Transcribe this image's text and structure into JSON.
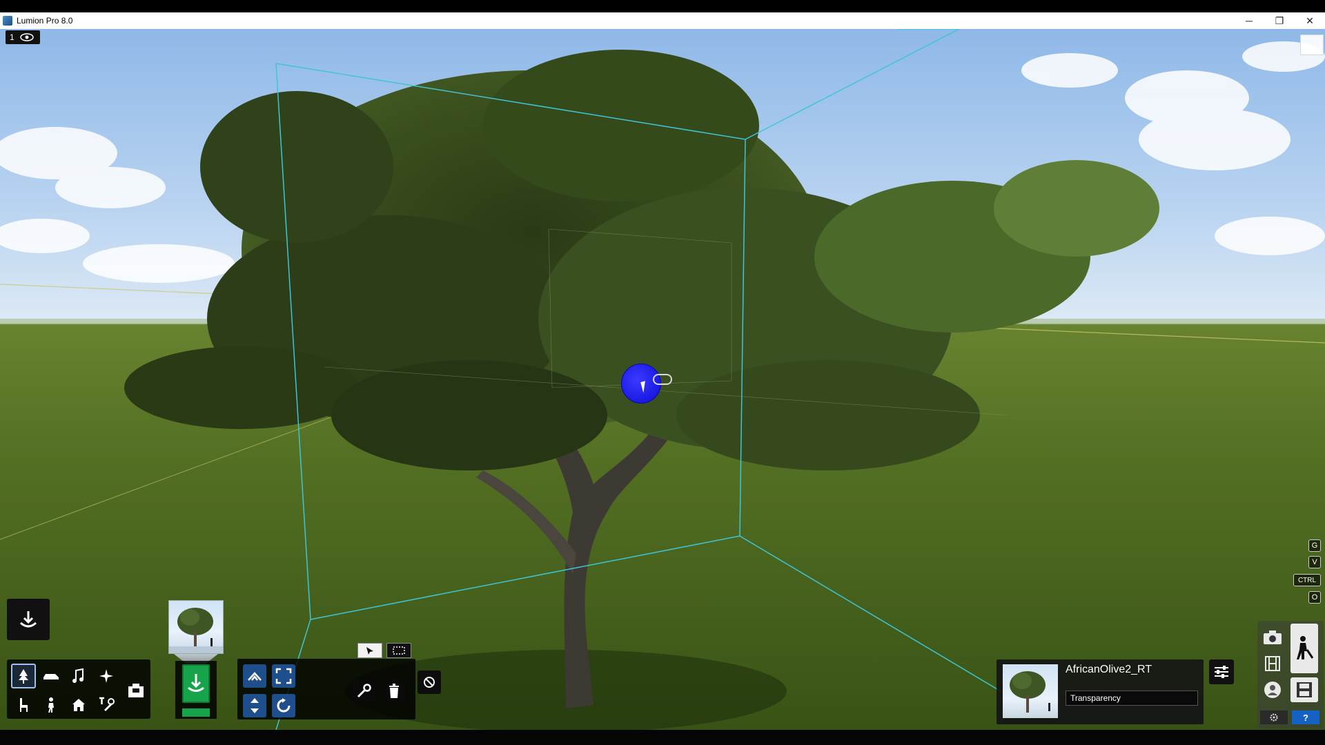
{
  "window": {
    "title": "Lumion Pro 8.0",
    "minimize_glyph": "─",
    "maximize_glyph": "❐",
    "close_glyph": "✕"
  },
  "viewport": {
    "camera_number": "1",
    "eye_icon": "eye-icon"
  },
  "bottom_toolbar": {
    "place_button_icon": "place-object-icon",
    "categories": [
      {
        "name": "nature",
        "icon": "tree-icon",
        "active": true
      },
      {
        "name": "transport",
        "icon": "car-icon",
        "active": false
      },
      {
        "name": "sound",
        "icon": "music-note-icon",
        "active": false
      },
      {
        "name": "special-effects",
        "icon": "sparkle-icon",
        "active": false
      },
      {
        "name": "indoor",
        "icon": "chair-icon",
        "active": false
      },
      {
        "name": "people-animals",
        "icon": "person-icon",
        "active": false
      },
      {
        "name": "outdoor",
        "icon": "house-icon",
        "active": false
      },
      {
        "name": "utilities",
        "icon": "tools-icon",
        "active": false
      },
      {
        "name": "imported-models",
        "icon": "import-icon",
        "active": false
      }
    ],
    "library_thumb_icon": "tree-thumbnail",
    "add_object_icon": "add-object-icon",
    "tool_icons": {
      "move": "move-icon",
      "scale": "scale-icon",
      "height": "height-icon",
      "rotate": "rotate-icon",
      "edit": "wrench-icon",
      "delete": "trash-icon",
      "select": "cursor-icon",
      "box_select": "box-select-icon",
      "deselect": "no-icon"
    }
  },
  "keyboard_hints": {
    "g": "G",
    "v": "V",
    "ctrl": "CTRL",
    "o": "O"
  },
  "properties": {
    "object_name": "AfricanOlive2_RT",
    "field_label": "Transparency",
    "settings_icon": "sliders-icon"
  },
  "mode_buttons": {
    "photo": "camera-icon",
    "movie": "film-icon",
    "panorama": "panorama-icon",
    "build": "build-mode-icon",
    "save": "save-icon",
    "settings": "gear-icon",
    "help": "?"
  },
  "colors": {
    "selection_box": "#3fc5d6",
    "accent_green": "#16a34a",
    "accent_blue": "#1f4e8c",
    "sphere_blue": "#1414ee"
  }
}
